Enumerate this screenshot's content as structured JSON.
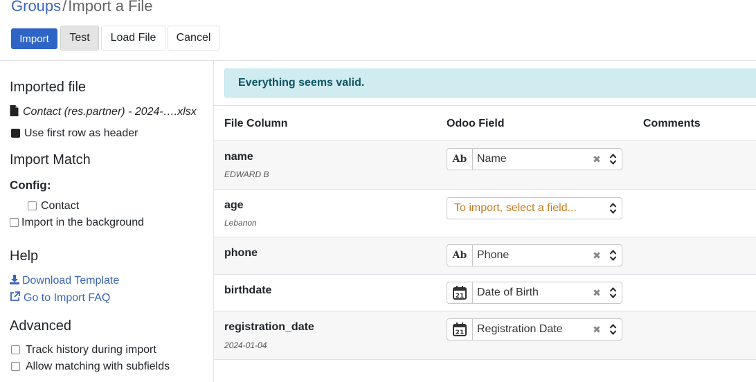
{
  "breadcrumb": {
    "parent": "Groups",
    "separator": "/",
    "current": "Import a File"
  },
  "toolbar": {
    "import_label": "Import",
    "test_label": "Test",
    "load_label": "Load File",
    "cancel_label": "Cancel"
  },
  "sidebar": {
    "imported_file_title": "Imported file",
    "file_name": "Contact (res.partner) - 2024-….xlsx",
    "first_row_header_label": "Use first row as header",
    "import_match_title": "Import Match",
    "config_label": "Config:",
    "contact_label": "Contact",
    "background_label": "Import in the background",
    "help_title": "Help",
    "download_template_label": "Download Template",
    "faq_label": "Go to Import FAQ",
    "advanced_title": "Advanced",
    "track_history_label": "Track history during import",
    "allow_matching_label": "Allow matching with subfields"
  },
  "alert": {
    "message": "Everything seems valid."
  },
  "table": {
    "headers": {
      "file_column": "File Column",
      "odoo_field": "Odoo Field",
      "comments": "Comments"
    },
    "rows": [
      {
        "column": "name",
        "sample": "EDWARD B",
        "field": "Name",
        "field_type_icon": "text-ab-icon"
      },
      {
        "column": "age",
        "sample": "Lebanon",
        "field": "",
        "placeholder": "To import, select a field...",
        "field_type_icon": ""
      },
      {
        "column": "phone",
        "sample": "",
        "field": "Phone",
        "field_type_icon": "text-ab-icon"
      },
      {
        "column": "birthdate",
        "sample": "",
        "field": "Date of Birth",
        "field_type_icon": "calendar-icon"
      },
      {
        "column": "registration_date",
        "sample": "2024-01-04",
        "field": "Registration Date",
        "field_type_icon": "calendar-icon"
      }
    ]
  },
  "colors": {
    "primary": "#2f64c7",
    "link": "#3a66b8",
    "alert_bg": "#d1ecf1",
    "alert_text": "#0c5460",
    "placeholder": "#c47a1e"
  }
}
